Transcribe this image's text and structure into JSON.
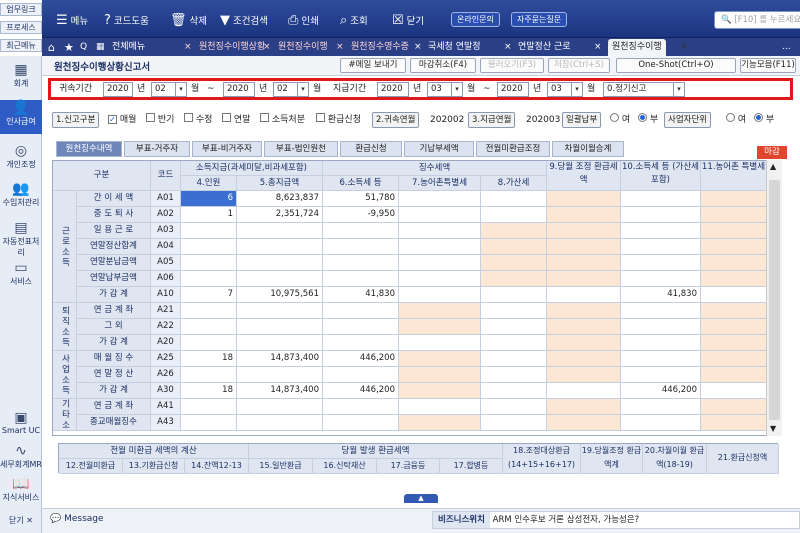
{
  "quick_tabs": [
    "업무링크",
    "프로세스",
    "최근메뉴"
  ],
  "toolbar": {
    "menu": "메뉴",
    "code_help": "코드도움",
    "delete": "삭제",
    "condition_search": "조건검색",
    "print": "인쇄",
    "lookup": "조회",
    "close": "닫기",
    "online_inquiry": "온라인문의",
    "faq": "자주묻는질문",
    "search_placeholder": "[F10] 를 누르세요"
  },
  "tabs": {
    "all_menu": "전체메뉴",
    "t1": "원천징수이행상황",
    "t2": "원천징수이행",
    "t3": "원천징수영수증",
    "t4": "국세청 연말정",
    "t5": "연말정산 근로",
    "t6": "원천징수이행",
    "close_x": "×",
    "more": "..."
  },
  "sidebar": {
    "items": [
      "회계",
      "인사급여",
      "개인조정",
      "수임처관리",
      "자동전표처리",
      "서비스",
      "Smart UC",
      "세무회계MR",
      "지식서비스",
      "닫기"
    ]
  },
  "page": {
    "title": "원천징수이행상황신고서",
    "buttons": [
      "#메일 보내기",
      "마감취소(F4)",
      "불러오기(F3)",
      "저장(Ctrl+S)",
      "One-Shot(Ctrl+O)",
      "기능모음(F11)"
    ]
  },
  "period": {
    "label_belong": "귀속기간",
    "label_pay": "지급기간",
    "y1": "2020",
    "m1": "02",
    "y2": "2020",
    "m2": "02",
    "y3": "2020",
    "m3": "03",
    "y4": "2020",
    "m4": "03",
    "unit_year": "년",
    "unit_month": "월",
    "tilde": "~",
    "report_type": "0.정기신고"
  },
  "options": {
    "report_kind_btn": "1.신고구분",
    "monthly": "매월",
    "half": "반기",
    "amend": "수정",
    "year_end": "연말",
    "income_disposal": "소득처분",
    "refund_apply": "환급신청",
    "btn_attr_year": "2.귀속연월",
    "attr_year_val": "202002",
    "btn_pay_year": "3.지급연월",
    "pay_year_val": "202003",
    "lump_pay": "일괄납부",
    "yes": "여",
    "no": "부",
    "business_unit": "사업자단위",
    "yes2": "여",
    "no2": "부"
  },
  "subtabs": [
    "원천징수내역",
    "부표-거주자",
    "부표-비거주자",
    "부표-법인원천",
    "환급신청",
    "기납부세액",
    "전월미환급조정",
    "차월이월승계"
  ],
  "closed_badge": "마감",
  "grid": {
    "col_group_pay": "소득지급(과세미달,비과세포함)",
    "col_group_tax": "징수세액",
    "headers": [
      "구분",
      "코드",
      "4.인원",
      "5.총지급액",
      "6.소득세 등",
      "7.농어촌특별세",
      "8.가산세",
      "9.당월 조정 환급세액",
      "10.소득세 등 (가산세 포함)",
      "11.농어촌 특별세"
    ],
    "groups": [
      "근로소득",
      "퇴직소득",
      "사업소득",
      "기타소득"
    ],
    "rows": [
      {
        "label": "간 이 세 액",
        "code": "A01",
        "people": "6",
        "total": "8,623,837",
        "tax": "51,780",
        "paid": ""
      },
      {
        "label": "중 도 퇴 사",
        "code": "A02",
        "people": "1",
        "total": "2,351,724",
        "tax": "-9,950",
        "paid": ""
      },
      {
        "label": "일 용 근 로",
        "code": "A03",
        "people": "",
        "total": "",
        "tax": "",
        "paid": ""
      },
      {
        "label": "연말정산합계",
        "code": "A04",
        "people": "",
        "total": "",
        "tax": "",
        "paid": ""
      },
      {
        "label": "연말분납금액",
        "code": "A05",
        "people": "",
        "total": "",
        "tax": "",
        "paid": ""
      },
      {
        "label": "연말납부금액",
        "code": "A06",
        "people": "",
        "total": "",
        "tax": "",
        "paid": ""
      },
      {
        "label": "가 감 계",
        "code": "A10",
        "people": "7",
        "total": "10,975,561",
        "tax": "41,830",
        "paid": "41,830"
      },
      {
        "label": "연 금 계 좌",
        "code": "A21",
        "people": "",
        "total": "",
        "tax": "",
        "paid": ""
      },
      {
        "label": "그 외",
        "code": "A22",
        "people": "",
        "total": "",
        "tax": "",
        "paid": ""
      },
      {
        "label": "가 감 계",
        "code": "A20",
        "people": "",
        "total": "",
        "tax": "",
        "paid": ""
      },
      {
        "label": "매 월 징 수",
        "code": "A25",
        "people": "18",
        "total": "14,873,400",
        "tax": "446,200",
        "paid": ""
      },
      {
        "label": "연 말 정 산",
        "code": "A26",
        "people": "",
        "total": "",
        "tax": "",
        "paid": ""
      },
      {
        "label": "가 감 계",
        "code": "A30",
        "people": "18",
        "total": "14,873,400",
        "tax": "446,200",
        "paid": "446,200"
      },
      {
        "label": "연 금 계 좌",
        "code": "A41",
        "people": "",
        "total": "",
        "tax": "",
        "paid": ""
      },
      {
        "label": "종교매월징수",
        "code": "A43",
        "people": "",
        "total": "",
        "tax": "",
        "paid": ""
      }
    ]
  },
  "summary": {
    "g1": "전월 미환급 세액의 계산",
    "g2": "당월 발생 환급세액",
    "c18": "18.조정대상환급 (14+15+16+17)",
    "c19": "19.당월조정 환급액계",
    "c20": "20.차월이월 환급액(18-19)",
    "c21": "21.환급신청액",
    "sub": [
      "12.전월미환급",
      "13.기환급신청",
      "14.잔액12-13",
      "15.일반환급",
      "16.신탁재산",
      "17.금융등",
      "17.합병등"
    ]
  },
  "message": {
    "label": "Message",
    "biz_label": "비즈니스위치",
    "biz_text": "ARM 인수후보 거론 삼성전자, 가능성은?"
  },
  "colors": {
    "toolbar": "#1f3a8a",
    "accent_red": "#e01818",
    "selected": "#3b6ed1",
    "peach": "#fbe7d3"
  }
}
